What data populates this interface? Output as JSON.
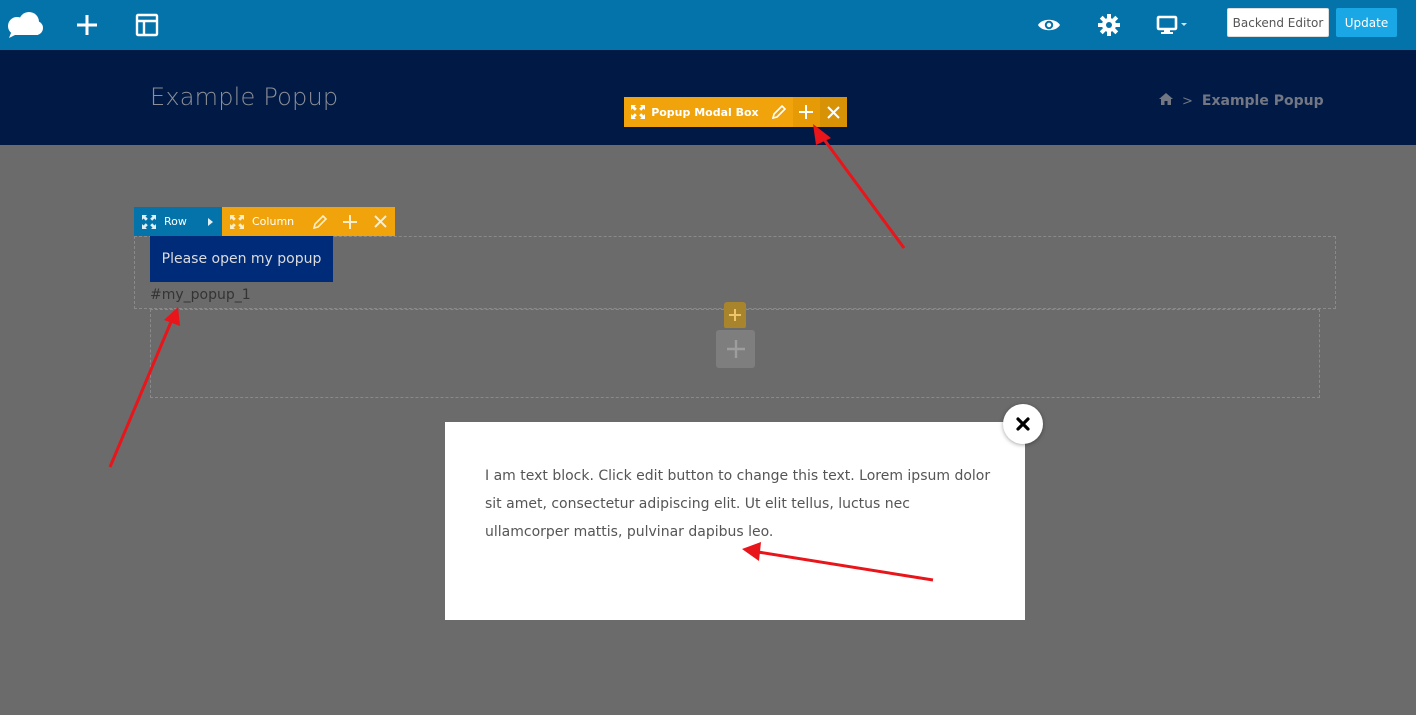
{
  "toolbar": {
    "backend_editor_label": "Backend Editor",
    "update_label": "Update",
    "icons": [
      "logo-cloud-icon",
      "add-element-icon",
      "templates-icon",
      "preview-eye-icon",
      "settings-gear-icon",
      "responsive-desktop-icon"
    ]
  },
  "header": {
    "title": "Example Popup",
    "breadcrumb": {
      "current": "Example Popup",
      "separator": ">"
    }
  },
  "popup_control": {
    "label": "Popup Modal Box"
  },
  "row_control": {
    "row_label": "Row",
    "column_label": "Column"
  },
  "content": {
    "open_button_label": "Please open my popup",
    "anchor_text": "#my_popup_1"
  },
  "modal": {
    "text": "I am text block. Click edit button to change this text. Lorem ipsum dolor sit amet, consectetur adipiscing elit. Ut elit tellus, luctus nec ullamcorper mattis, pulvinar dapibus leo."
  },
  "colors": {
    "toolbar": "#0473aa",
    "header": "#001a45",
    "accent_orange": "#f0a30a",
    "update_button": "#1aa7e6",
    "annotation_arrow": "#e8151a"
  }
}
